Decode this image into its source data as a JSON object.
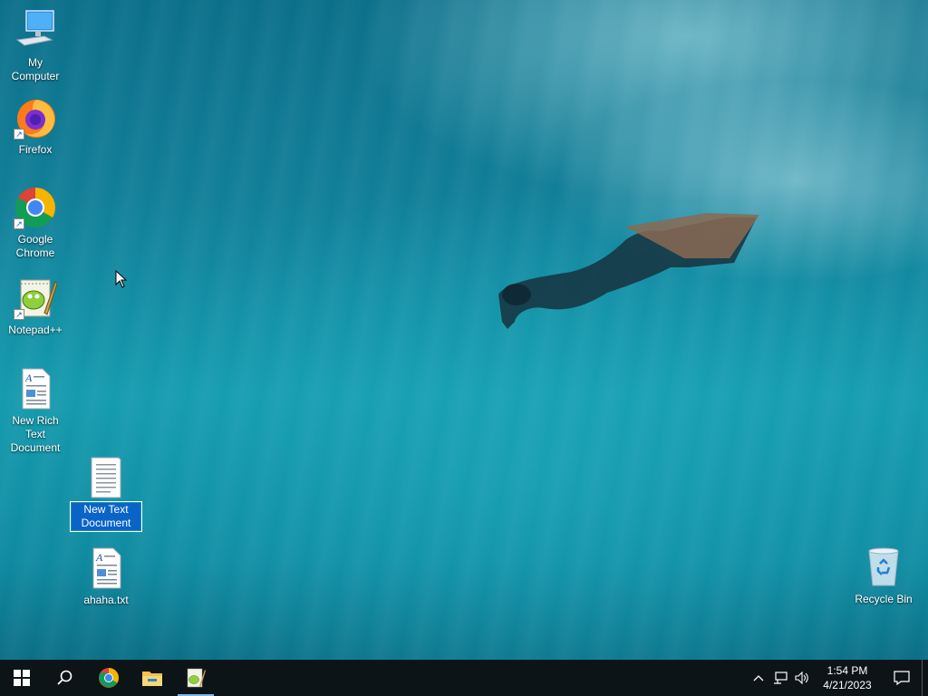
{
  "desktop": {
    "icons": [
      {
        "label": "My Computer",
        "icon": "computer-icon"
      },
      {
        "label": "Firefox",
        "icon": "firefox-icon"
      },
      {
        "label": "Google Chrome",
        "icon": "chrome-icon"
      },
      {
        "label": "Notepad++",
        "icon": "notepad-plus-plus-icon"
      },
      {
        "label": "New Rich Text Document",
        "icon": "rich-text-document-icon"
      },
      {
        "label": "New Text Document",
        "icon": "text-document-icon"
      },
      {
        "label": "ahaha.txt",
        "icon": "rich-text-document-icon"
      },
      {
        "label": "Recycle Bin",
        "icon": "recycle-bin-icon"
      }
    ]
  },
  "taskbar": {
    "start_icon": "windows-start-icon",
    "search_icon": "search-icon",
    "pinned": [
      "chrome-icon",
      "file-explorer-icon",
      "notepad-plus-plus-icon"
    ],
    "clock_time": "1:54 PM",
    "clock_date": "4/21/2023"
  },
  "colors": {
    "taskbar": "#0d1418",
    "selection": "#0a64c8",
    "active_indicator": "#76b9ed"
  }
}
